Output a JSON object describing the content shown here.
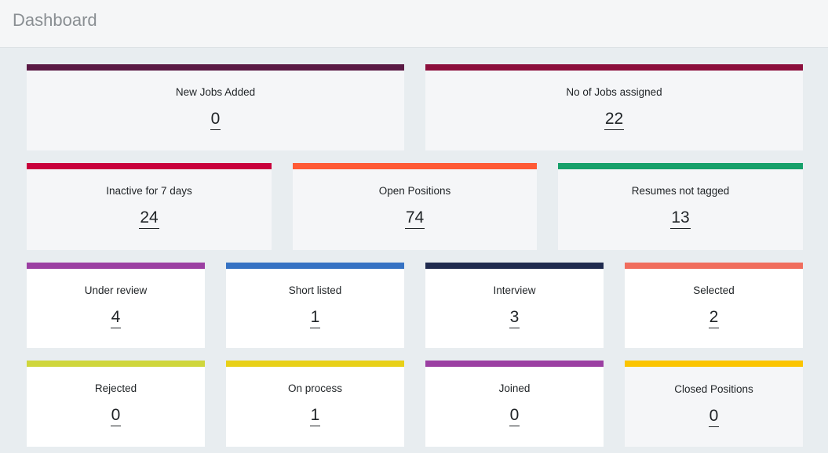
{
  "header": {
    "title": "Dashboard"
  },
  "cards": [
    {
      "label": "New Jobs Added",
      "value": "0",
      "color": "#5a1a44"
    },
    {
      "label": "No of Jobs assigned",
      "value": "22",
      "color": "#8c0f3c"
    },
    {
      "label": "Inactive for 7 days",
      "value": "24",
      "color": "#c8003c"
    },
    {
      "label": "Open Positions",
      "value": "74",
      "color": "#ff5a35"
    },
    {
      "label": "Resumes not tagged",
      "value": "13",
      "color": "#16a06a"
    },
    {
      "label": "Under review",
      "value": "4",
      "color": "#9b3fa2"
    },
    {
      "label": "Short listed",
      "value": "1",
      "color": "#3572c3"
    },
    {
      "label": "Interview",
      "value": "3",
      "color": "#1f2a4e"
    },
    {
      "label": "Selected",
      "value": "2",
      "color": "#f06d5d"
    },
    {
      "label": "Rejected",
      "value": "0",
      "color": "#cfd63c"
    },
    {
      "label": "On process",
      "value": "1",
      "color": "#e8d017"
    },
    {
      "label": "Joined",
      "value": "0",
      "color": "#9b3fa2"
    },
    {
      "label": "Closed Positions",
      "value": "0",
      "color": "#fbc400"
    }
  ]
}
